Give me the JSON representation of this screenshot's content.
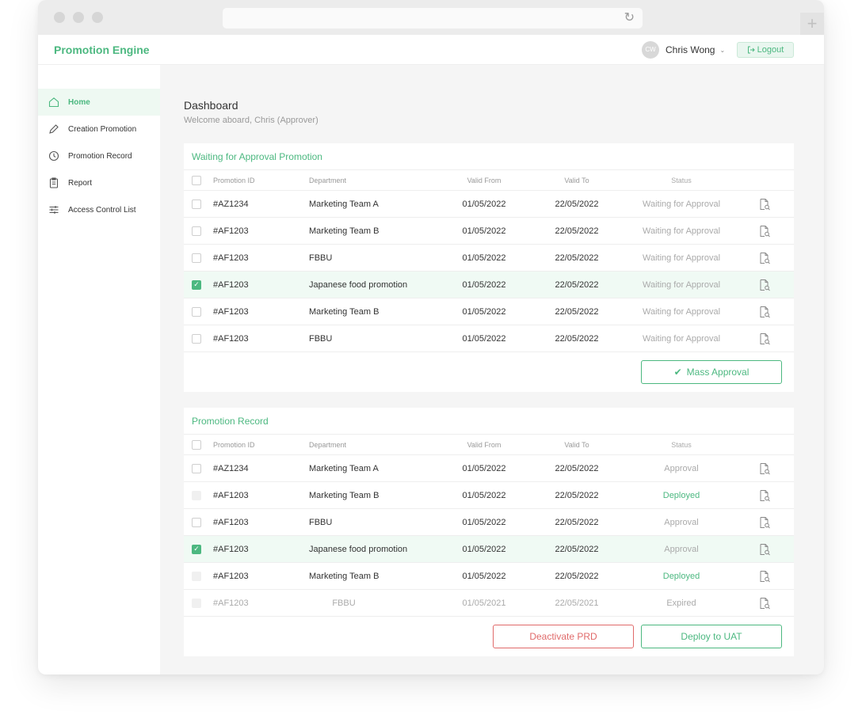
{
  "app": {
    "title": "Promotion Engine"
  },
  "user": {
    "initials": "CW",
    "name": "Chris Wong",
    "logout_label": "Logout"
  },
  "sidebar": {
    "items": [
      {
        "label": "Home",
        "icon": "home-icon",
        "active": true
      },
      {
        "label": "Creation Promotion",
        "icon": "pencil-icon",
        "active": false
      },
      {
        "label": "Promotion Record",
        "icon": "clock-icon",
        "active": false
      },
      {
        "label": "Report",
        "icon": "clipboard-icon",
        "active": false
      },
      {
        "label": "Access Control List",
        "icon": "sliders-icon",
        "active": false
      }
    ]
  },
  "dashboard": {
    "title": "Dashboard",
    "welcome": "Welcome aboard, Chris (Approver)"
  },
  "columns": {
    "id": "Promotion ID",
    "department": "Department",
    "valid_from": "Valid From",
    "valid_to": "Valid To",
    "status": "Status"
  },
  "approval_section": {
    "title": "Waiting for Approval Promotion",
    "rows": [
      {
        "id": "#AZ1234",
        "department": "Marketing Team A",
        "valid_from": "01/05/2022",
        "valid_to": "22/05/2022",
        "status": "Waiting for Approval",
        "checked": false
      },
      {
        "id": "#AF1203",
        "department": "Marketing Team B",
        "valid_from": "01/05/2022",
        "valid_to": "22/05/2022",
        "status": "Waiting for Approval",
        "checked": false
      },
      {
        "id": "#AF1203",
        "department": "FBBU",
        "valid_from": "01/05/2022",
        "valid_to": "22/05/2022",
        "status": "Waiting for Approval",
        "checked": false
      },
      {
        "id": "#AF1203",
        "department": "Japanese food promotion",
        "valid_from": "01/05/2022",
        "valid_to": "22/05/2022",
        "status": "Waiting for Approval",
        "checked": true
      },
      {
        "id": "#AF1203",
        "department": "Marketing Team B",
        "valid_from": "01/05/2022",
        "valid_to": "22/05/2022",
        "status": "Waiting for Approval",
        "checked": false
      },
      {
        "id": "#AF1203",
        "department": "FBBU",
        "valid_from": "01/05/2022",
        "valid_to": "22/05/2022",
        "status": "Waiting for Approval",
        "checked": false
      }
    ],
    "mass_approval_label": "Mass Approval"
  },
  "record_section": {
    "title": "Promotion Record",
    "rows": [
      {
        "id": "#AZ1234",
        "department": "Marketing Team A",
        "valid_from": "01/05/2022",
        "valid_to": "22/05/2022",
        "status": "Approval",
        "checked": false,
        "disabled": false,
        "dim": false,
        "status_color": "#aaaaaa"
      },
      {
        "id": "#AF1203",
        "department": "Marketing Team B",
        "valid_from": "01/05/2022",
        "valid_to": "22/05/2022",
        "status": "Deployed",
        "checked": false,
        "disabled": true,
        "dim": false,
        "status_color": "#4cb880"
      },
      {
        "id": "#AF1203",
        "department": "FBBU",
        "valid_from": "01/05/2022",
        "valid_to": "22/05/2022",
        "status": "Approval",
        "checked": false,
        "disabled": false,
        "dim": false,
        "status_color": "#aaaaaa"
      },
      {
        "id": "#AF1203",
        "department": "Japanese food promotion",
        "valid_from": "01/05/2022",
        "valid_to": "22/05/2022",
        "status": "Approval",
        "checked": true,
        "disabled": false,
        "dim": false,
        "status_color": "#aaaaaa"
      },
      {
        "id": "#AF1203",
        "department": "Marketing Team B",
        "valid_from": "01/05/2022",
        "valid_to": "22/05/2022",
        "status": "Deployed",
        "checked": false,
        "disabled": true,
        "dim": false,
        "status_color": "#4cb880"
      },
      {
        "id": "#AF1203",
        "department": "FBBU",
        "valid_from": "01/05/2021",
        "valid_to": "22/05/2021",
        "status": "Expired",
        "checked": false,
        "disabled": true,
        "dim": true,
        "status_color": "#aaaaaa"
      }
    ],
    "deactivate_label": "Deactivate PRD",
    "deploy_label": "Deploy to UAT"
  },
  "colors": {
    "brand": "#4cb880",
    "danger": "#e06a6a",
    "selected_row": "#f0faf4"
  }
}
